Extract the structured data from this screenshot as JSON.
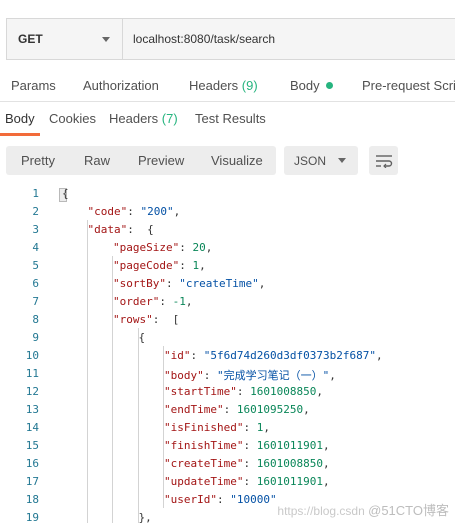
{
  "request": {
    "method": "GET",
    "url": "localhost:8080/task/search"
  },
  "request_tabs": {
    "params": "Params",
    "authorization": "Authorization",
    "headers": "Headers",
    "headers_count": "(9)",
    "body": "Body",
    "pre_request": "Pre-request Scrip"
  },
  "response_tabs": {
    "body": "Body",
    "cookies": "Cookies",
    "headers": "Headers",
    "headers_count": "(7)",
    "test_results": "Test Results"
  },
  "toolbar": {
    "pretty": "Pretty",
    "raw": "Raw",
    "preview": "Preview",
    "visualize": "Visualize",
    "format": "JSON",
    "wrap_icon": "wrap-lines-icon"
  },
  "code_lines": [
    {
      "n": "1",
      "t": "{"
    },
    {
      "n": "2",
      "k": "\"code\"",
      "v": "\"200\"",
      "vt": "str",
      "e": ","
    },
    {
      "n": "3",
      "k": "\"data\"",
      "e": " {"
    },
    {
      "n": "4",
      "k": "\"pageSize\"",
      "v": "20",
      "vt": "num",
      "e": ","
    },
    {
      "n": "5",
      "k": "\"pageCode\"",
      "v": "1",
      "vt": "num",
      "e": ","
    },
    {
      "n": "6",
      "k": "\"sortBy\"",
      "v": "\"createTime\"",
      "vt": "str",
      "e": ","
    },
    {
      "n": "7",
      "k": "\"order\"",
      "v": "-1",
      "vt": "num",
      "e": ","
    },
    {
      "n": "8",
      "k": "\"rows\"",
      "e": " ["
    },
    {
      "n": "9",
      "t": "{"
    },
    {
      "n": "10",
      "k": "\"id\"",
      "v": "\"5f6d74d260d3df0373b2f687\"",
      "vt": "str",
      "e": ","
    },
    {
      "n": "11",
      "k": "\"body\"",
      "v": "\"完成学习笔记（一）\"",
      "vt": "str",
      "e": ","
    },
    {
      "n": "12",
      "k": "\"startTime\"",
      "v": "1601008850",
      "vt": "num",
      "e": ","
    },
    {
      "n": "13",
      "k": "\"endTime\"",
      "v": "1601095250",
      "vt": "num",
      "e": ","
    },
    {
      "n": "14",
      "k": "\"isFinished\"",
      "v": "1",
      "vt": "num",
      "e": ","
    },
    {
      "n": "15",
      "k": "\"finishTime\"",
      "v": "1601011901",
      "vt": "num",
      "e": ","
    },
    {
      "n": "16",
      "k": "\"createTime\"",
      "v": "1601008850",
      "vt": "num",
      "e": ","
    },
    {
      "n": "17",
      "k": "\"updateTime\"",
      "v": "1601011901",
      "vt": "num",
      "e": ","
    },
    {
      "n": "18",
      "k": "\"userId\"",
      "v": "\"10000\"",
      "vt": "str",
      "e": ""
    },
    {
      "n": "19",
      "t": "},"
    }
  ],
  "watermark": {
    "url": "https://blog.csdn",
    "brand": "@51CTO博客"
  }
}
